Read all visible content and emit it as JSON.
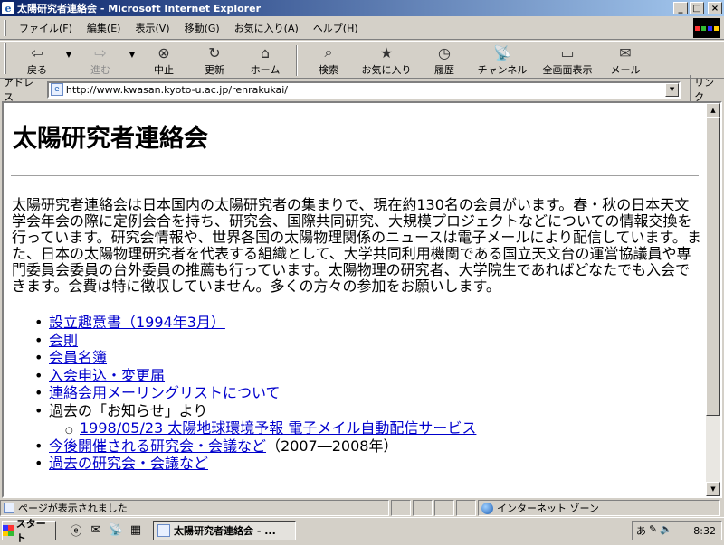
{
  "window": {
    "title": "太陽研究者連絡会 - Microsoft Internet Explorer",
    "controls": {
      "minimize": "_",
      "maximize": "□",
      "close": "×"
    }
  },
  "menu": [
    "ファイル(F)",
    "編集(E)",
    "表示(V)",
    "移動(G)",
    "お気に入り(A)",
    "ヘルプ(H)"
  ],
  "toolbar": {
    "back": "戻る",
    "forward": "進む",
    "stop": "中止",
    "refresh": "更新",
    "home": "ホーム",
    "search": "検索",
    "favorites": "お気に入り",
    "history": "履歴",
    "channels": "チャンネル",
    "fullscreen": "全画面表示",
    "mail": "メール"
  },
  "address": {
    "label": "アドレス",
    "url": "http://www.kwasan.kyoto-u.ac.jp/renrakukai/",
    "links_label": "リンク"
  },
  "page": {
    "title": "太陽研究者連絡会",
    "description": "太陽研究者連絡会は日本国内の太陽研究者の集まりで、現在約130名の会員がいます。春・秋の日本天文学会年会の際に定例会合を持ち、研究会、国際共同研究、大規模プロジェクトなどについての情報交換を行っています。研究会情報や、世界各国の太陽物理関係のニュースは電子メールにより配信しています。また、日本の太陽物理研究者を代表する組織として、大学共同利用機関である国立天文台の運営協議員や専門委員会委員の台外委員の推薦も行っています。太陽物理の研究者、大学院生であればどなたでも入会できます。会費は特に徴収していません。多くの方々の参加をお願いします。",
    "links": {
      "prospectus": "設立趣意書（1994年3月）",
      "rules": "会則",
      "members": "会員名簿",
      "membership": "入会申込・変更届",
      "mailing_list": "連絡会用メーリングリストについて",
      "past_news_label": "過去の「お知らせ」より",
      "past_news_item": "1998/05/23 太陽地球環境予報 電子メイル自動配信サービス",
      "upcoming": "今後開催される研究会・会議など",
      "upcoming_suffix": "（2007―2008年）",
      "past_meetings": "過去の研究会・会議など"
    }
  },
  "status": {
    "text": "ページが表示されました",
    "zone": "インターネット ゾーン"
  },
  "taskbar": {
    "start": "スタート",
    "task": "太陽研究者連絡会 - ...",
    "clock": "8:32"
  }
}
